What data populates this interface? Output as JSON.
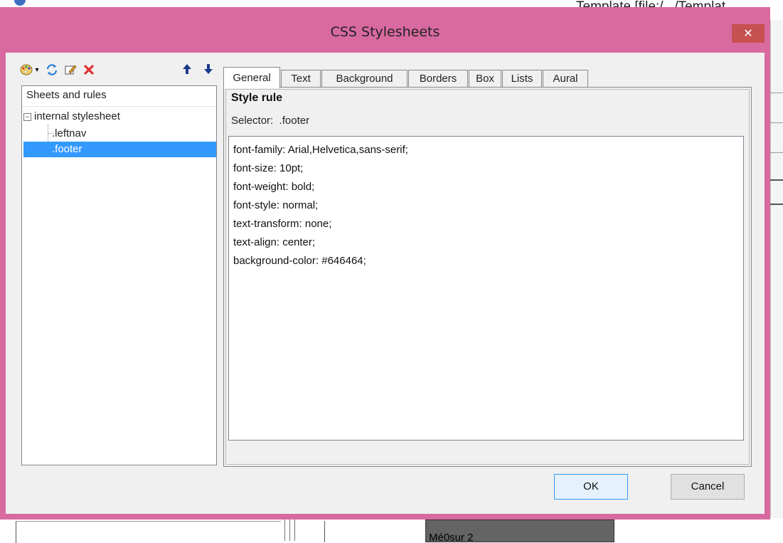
{
  "background": {
    "window_title": "Template [file:/.../Templat",
    "footer_text": "Mé0sur 2"
  },
  "dialog": {
    "title": "CSS Stylesheets",
    "close_glyph": "✕"
  },
  "toolbar": {
    "icons": [
      "palette-icon",
      "dropdown-arrow-icon",
      "refresh-icon",
      "edit-icon",
      "delete-icon",
      "move-up-icon",
      "move-down-icon"
    ]
  },
  "tree": {
    "header": "Sheets and rules",
    "expand_glyph": "−",
    "root": "internal stylesheet",
    "rules": [
      ".leftnav",
      ".footer"
    ],
    "selected_index": 1
  },
  "tabs": [
    "General",
    "Text",
    "Background",
    "Borders",
    "Box",
    "Lists",
    "Aural"
  ],
  "active_tab": "General",
  "panel": {
    "heading": "Style rule",
    "selector_label": "Selector:",
    "selector_value": ".footer",
    "declarations": [
      "font-family: Arial,Helvetica,sans-serif;",
      "font-size: 10pt;",
      "font-weight: bold;",
      "font-style: normal;",
      "text-transform: none;",
      "text-align: center;",
      "background-color: #646464;"
    ]
  },
  "buttons": {
    "ok": "OK",
    "cancel": "Cancel"
  },
  "colors": {
    "dialog_frame": "#d86aa0",
    "selection": "#3399ff",
    "close_button": "#c75050",
    "footer_block": "#646464"
  }
}
